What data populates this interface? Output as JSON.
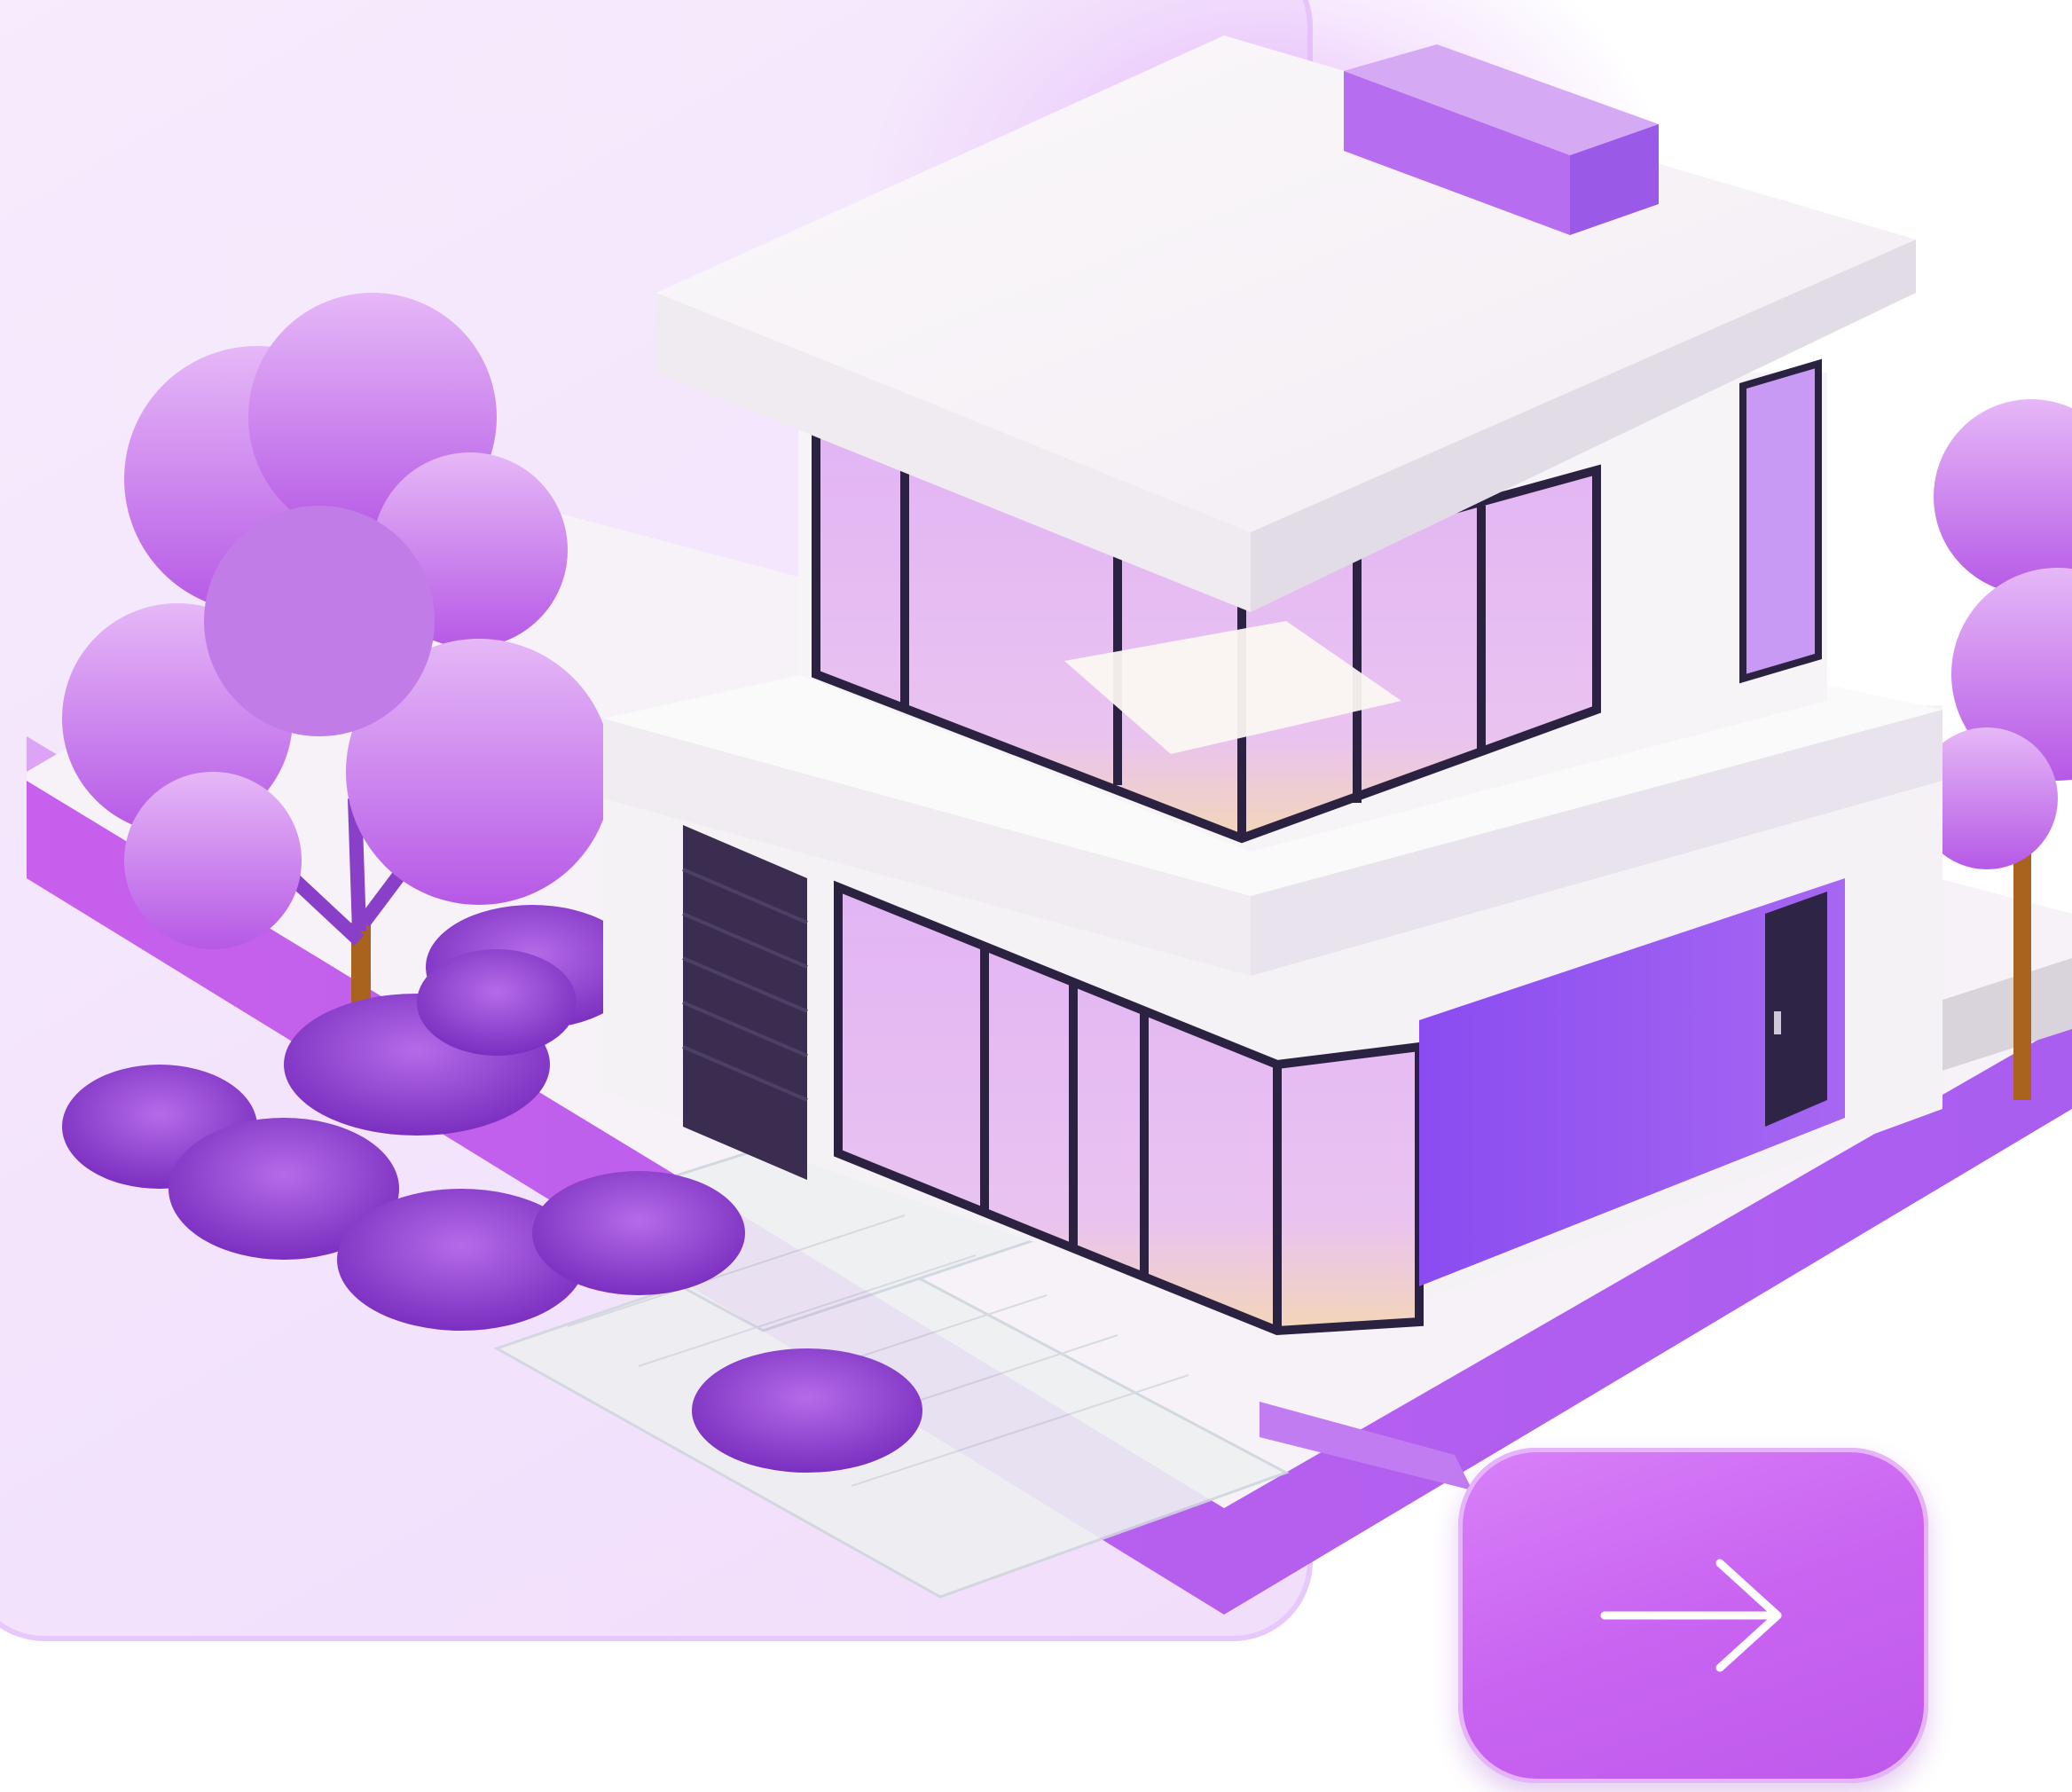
{
  "hero": {
    "illustration": "isometric-modern-house",
    "next_button": {
      "icon": "arrow-right-icon",
      "color": "#c964f1"
    }
  },
  "colors": {
    "panel_bg": "#f4e6fc",
    "accent": "#b45cf0",
    "accent_dark": "#7b3fe4",
    "wall_white": "#f7f3f8",
    "frame_dark": "#2b2140"
  }
}
